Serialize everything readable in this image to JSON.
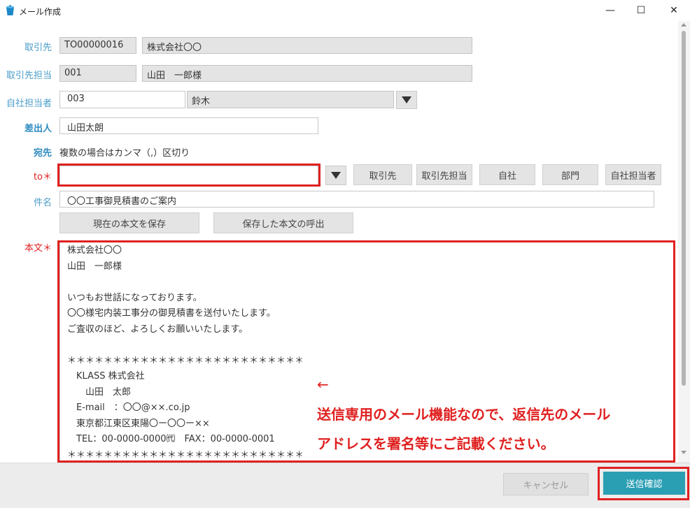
{
  "window": {
    "title": "メール作成",
    "minimize": "—",
    "maximize": "☐",
    "close": "✕"
  },
  "form": {
    "client": {
      "label": "取引先",
      "code": "TO00000016",
      "name": "株式会社〇〇"
    },
    "client_contact": {
      "label": "取引先担当",
      "code": "001",
      "name": "山田　一郎様"
    },
    "own_contact": {
      "label": "自社担当者",
      "code": "003",
      "name": "鈴木"
    },
    "sender": {
      "label": "差出人",
      "value": "山田太朗"
    },
    "to_heading": {
      "label": "宛先",
      "hint": "複数の場合はカンマ（,）区切り"
    },
    "to": {
      "label": "to＊",
      "value": "",
      "buttons": [
        "取引先",
        "取引先担当",
        "自社",
        "部門",
        "自社担当者"
      ]
    },
    "subject": {
      "label": "件名",
      "value": "〇〇工事御見積書のご案内"
    },
    "save_body_button": "現在の本文を保存",
    "load_body_button": "保存した本文の呼出",
    "body": {
      "label": "本文＊",
      "lines": [
        "株式会社〇〇",
        "山田　一郎様",
        "",
        "いつもお世話になっております。",
        "〇〇様宅内装工事分の御見積書を送付いたします。",
        "ご査収のほど、よろしくお願いいたします。",
        "",
        "＊＊＊＊＊＊＊＊＊＊＊＊＊＊＊＊＊＊＊＊＊＊＊＊＊＊",
        "　KLASS 株式会社",
        "　　山田　太郎",
        "　E-mail　：〇〇@××.co.jp",
        "　東京都江東区東陽〇ー〇〇ー××",
        "　TEL：00-0000-0000㈹　FAX：00-0000-0001",
        "＊＊＊＊＊＊＊＊＊＊＊＊＊＊＊＊＊＊＊＊＊＊＊＊＊＊"
      ]
    }
  },
  "annotation": {
    "arrow": "←",
    "line1": "送信専用のメール機能なので、返信先のメール",
    "line2": "アドレスを署名等にご記載ください。"
  },
  "footer": {
    "cancel_button": "キャンセル",
    "send_button": "送信確認"
  },
  "colors": {
    "label_blue": "#4a9cc8",
    "required_red": "#e02020",
    "send_teal": "#2a9fb4"
  }
}
